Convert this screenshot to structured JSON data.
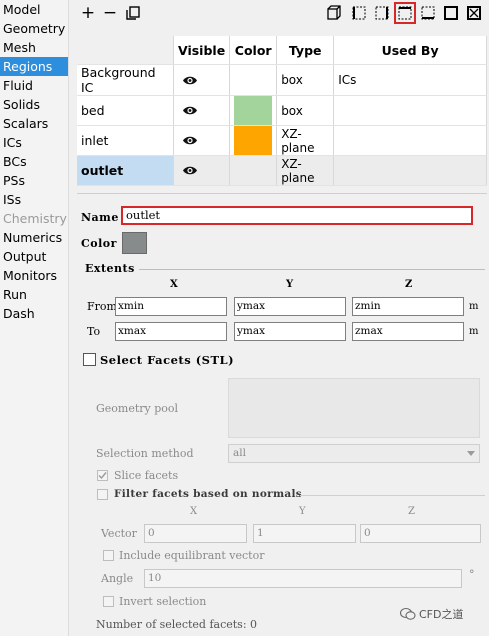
{
  "nav": {
    "items": [
      {
        "label": "Model"
      },
      {
        "label": "Geometry"
      },
      {
        "label": "Mesh"
      },
      {
        "label": "Regions"
      },
      {
        "label": "Fluid"
      },
      {
        "label": "Solids"
      },
      {
        "label": "Scalars"
      },
      {
        "label": "ICs"
      },
      {
        "label": "BCs"
      },
      {
        "label": "PSs"
      },
      {
        "label": "ISs"
      },
      {
        "label": "Chemistry"
      },
      {
        "label": "Numerics"
      },
      {
        "label": "Output"
      },
      {
        "label": "Monitors"
      },
      {
        "label": "Run"
      },
      {
        "label": "Dash"
      }
    ],
    "active": "Regions",
    "disabled": [
      "Chemistry"
    ]
  },
  "toolbar": {
    "add_label": "+",
    "remove_label": "−",
    "icons": [
      "duplicate-icon",
      "box-shape-icon",
      "yz-plane-icon",
      "xz-plane-icon",
      "xy-plane-icon",
      "point-icon",
      "stl-icon"
    ],
    "highlighted": "xz-plane-icon",
    "highlight_color": "#d62828"
  },
  "regions_table": {
    "headers": {
      "visible": "Visible",
      "color": "Color",
      "type": "Type",
      "used_by": "Used By"
    },
    "rows": [
      {
        "name": "Background IC",
        "color": "#ffffff",
        "type": "box",
        "used_by": "ICs"
      },
      {
        "name": "bed",
        "color": "#a3d49c",
        "type": "box",
        "used_by": ""
      },
      {
        "name": "inlet",
        "color": "#ffa500",
        "type": "XZ-plane",
        "used_by": ""
      },
      {
        "name": "outlet",
        "color": "#f0f0f0",
        "type": "XZ-plane",
        "used_by": ""
      }
    ],
    "selected": "outlet"
  },
  "details": {
    "name_label": "Name",
    "name_value": "outlet",
    "color_label": "Color",
    "color_value": "#888b8c",
    "extents_label": "Extents",
    "axes": [
      "X",
      "Y",
      "Z"
    ],
    "from_label": "From",
    "to_label": "To",
    "from": [
      "xmin",
      "ymax",
      "zmin"
    ],
    "to": [
      "xmax",
      "ymax",
      "zmax"
    ],
    "unit": "m",
    "select_facets_label": "Select Facets (STL)"
  },
  "stl": {
    "geometry_pool_label": "Geometry pool",
    "selection_method_label": "Selection method",
    "selection_method_value": "all",
    "slice_facets_label": "Slice facets",
    "filter_label": "Filter facets based on normals",
    "axes": [
      "X",
      "Y",
      "Z"
    ],
    "vector_label": "Vector",
    "vector": [
      "0",
      "1",
      "0"
    ],
    "include_equilibrant_label": "Include equilibrant vector",
    "angle_label": "Angle",
    "angle_value": "10",
    "angle_unit": "°",
    "invert_label": "Invert selection",
    "count_label": "Number of selected facets: 0"
  },
  "watermark": {
    "text": "CFD之道"
  }
}
